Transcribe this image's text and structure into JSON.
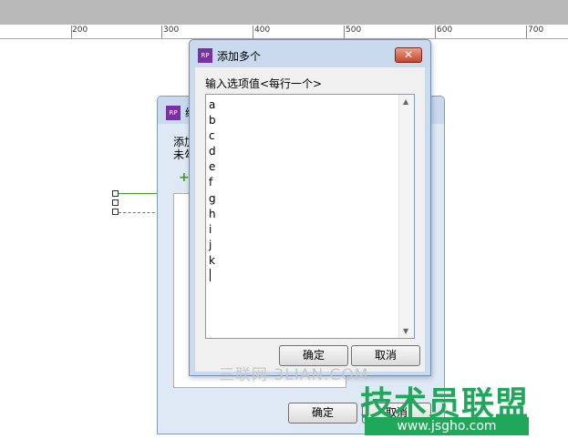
{
  "ruler": {
    "labels": [
      "200",
      "300",
      "400",
      "500",
      "600",
      "700"
    ]
  },
  "back_dialog": {
    "title_icon": "RP",
    "title_fragment": "编",
    "text_line1": "添加",
    "text_line2": "未勾",
    "ok_label": "确定",
    "cancel_label": "取消"
  },
  "dialog": {
    "title": "添加多个",
    "icon": "RP",
    "close_glyph": "✕",
    "prompt_label": "输入选项值<每行一个>",
    "items": [
      "a",
      "b",
      "c",
      "d",
      "e",
      "f",
      "g",
      "h",
      "i",
      "j",
      "k"
    ],
    "ok_label": "确定",
    "cancel_label": "取消"
  },
  "watermark": {
    "text": "三联网 3LIAN.COM"
  },
  "logo": {
    "text": "技术员联盟",
    "url": "www.jsgho.com"
  }
}
